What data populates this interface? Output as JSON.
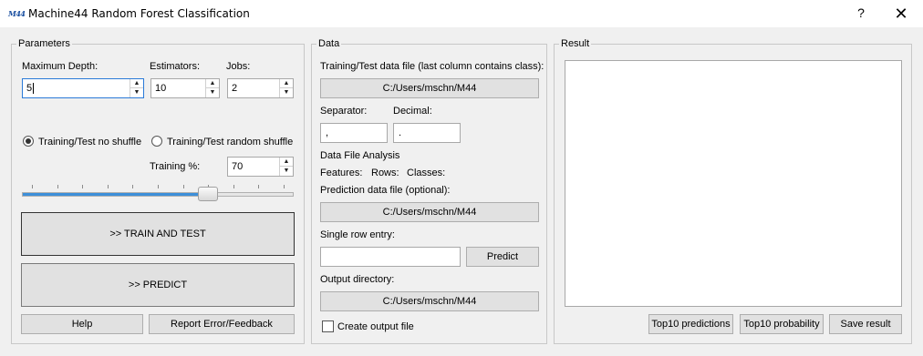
{
  "window": {
    "title": "Machine44 Random Forest Classification",
    "icon_text": "M44",
    "help_label": "?",
    "close_label": "✕"
  },
  "parameters": {
    "group_title": "Parameters",
    "max_depth_label": "Maximum Depth:",
    "max_depth_value": "5",
    "estimators_label": "Estimators:",
    "estimators_value": "10",
    "jobs_label": "Jobs:",
    "jobs_value": "2",
    "radio_no_shuffle_label": "Training/Test no shuffle",
    "radio_random_shuffle_label": "Training/Test random shuffle",
    "radio_selected": "no_shuffle",
    "training_pct_label": "Training %:",
    "training_pct_value": "70",
    "slider_fraction": 0.7,
    "train_test_label": ">> TRAIN AND TEST",
    "predict_label": ">> PREDICT",
    "help_label": "Help",
    "report_label": "Report Error/Feedback"
  },
  "data": {
    "group_title": "Data",
    "train_file_label": "Training/Test data file (last column contains class):",
    "train_file_path": "C:/Users/mschn/M44",
    "separator_label": "Separator:",
    "separator_value": ",",
    "decimal_label": "Decimal:",
    "decimal_value": ".",
    "analysis_label": "Data File Analysis",
    "features_label": "Features:",
    "rows_label": "Rows:",
    "classes_label": "Classes:",
    "prediction_file_label": "Prediction data file (optional):",
    "prediction_file_path": "C:/Users/mschn/M44",
    "single_row_label": "Single row entry:",
    "single_row_value": "",
    "predict_button_label": "Predict",
    "output_dir_label": "Output directory:",
    "output_dir_path": "C:/Users/mschn/M44",
    "create_output_label": "Create output file",
    "create_output_checked": false
  },
  "result": {
    "group_title": "Result",
    "top10_predictions_label": "Top10 predictions",
    "top10_probability_label": "Top10 probability",
    "save_result_label": "Save result"
  },
  "colors": {
    "accent": "#3c8fd9",
    "focus_border": "#2a7ad8"
  }
}
